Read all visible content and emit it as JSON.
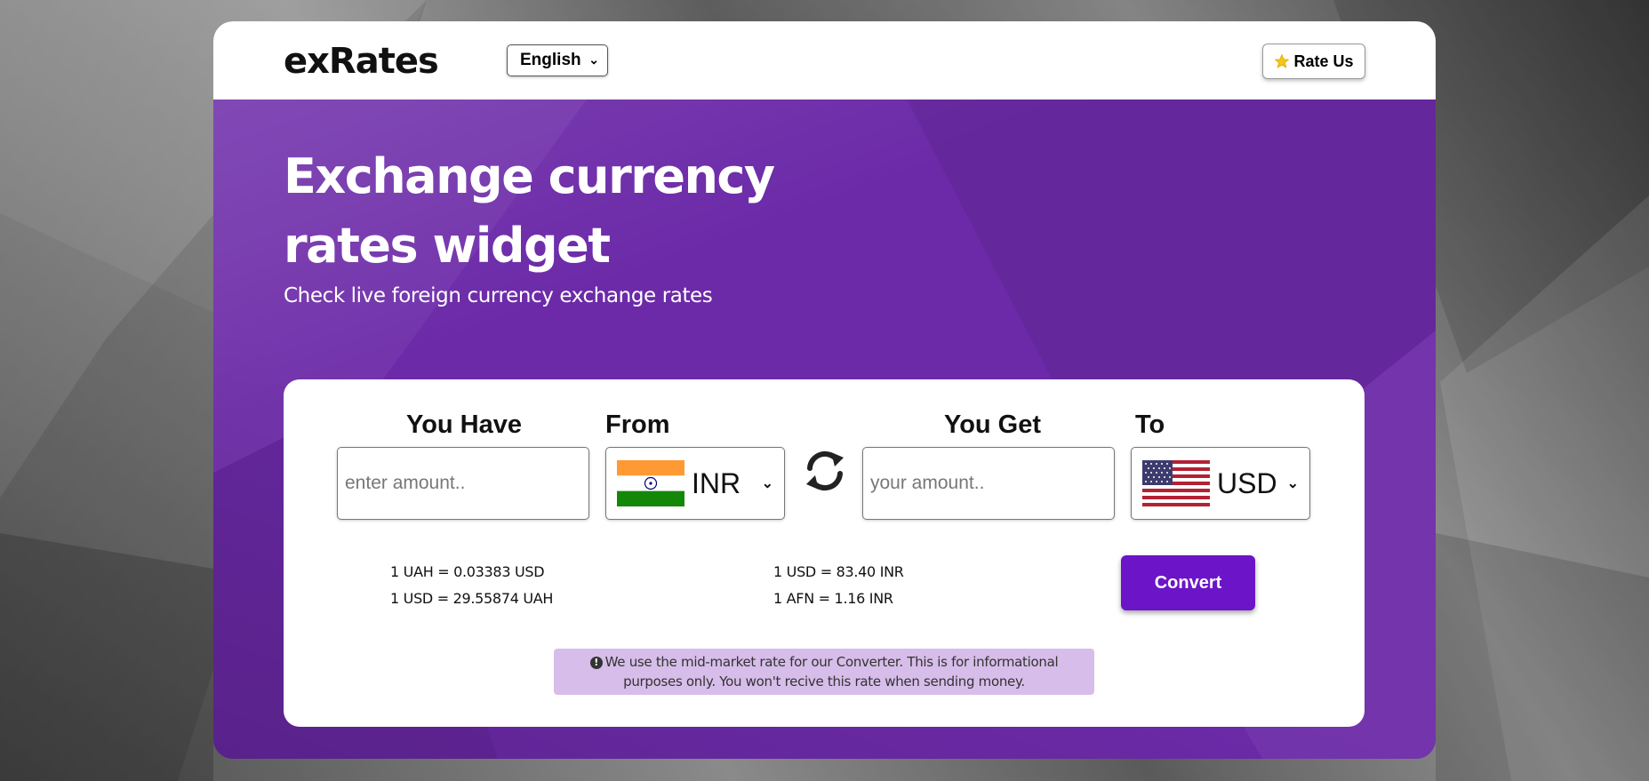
{
  "header": {
    "logo": "exRates",
    "language": "English",
    "rate_us": "Rate Us"
  },
  "hero": {
    "headline_line1": "Exchange currency",
    "headline_line2": "rates widget",
    "subheadline": "Check live foreign currency exchange rates"
  },
  "converter": {
    "you_have_label": "You Have",
    "from_label": "From",
    "you_get_label": "You Get",
    "to_label": "To",
    "have_placeholder": "enter amount..",
    "get_placeholder": "your amount..",
    "from_currency": "INR",
    "to_currency": "USD",
    "rates_left": [
      "1 UAH = 0.03383 USD",
      "1 USD = 29.55874 UAH"
    ],
    "rates_right": [
      "1 USD = 83.40 INR",
      "1 AFN = 1.16 INR"
    ],
    "convert_label": "Convert",
    "notice_line1": "We use the mid-market rate for our Converter. This is for informational",
    "notice_line2": "purposes only. You won't recive this rate when sending money.",
    "notice_icon": "!"
  },
  "colors": {
    "brand_purple": "#6c2aa8",
    "button_purple": "#6c14c8",
    "notice_bg": "#d7bde9"
  },
  "icons": {
    "swap": "swap-arrows-icon",
    "star": "star-icon",
    "india_flag": "india-flag-icon",
    "us_flag": "us-flag-icon"
  }
}
